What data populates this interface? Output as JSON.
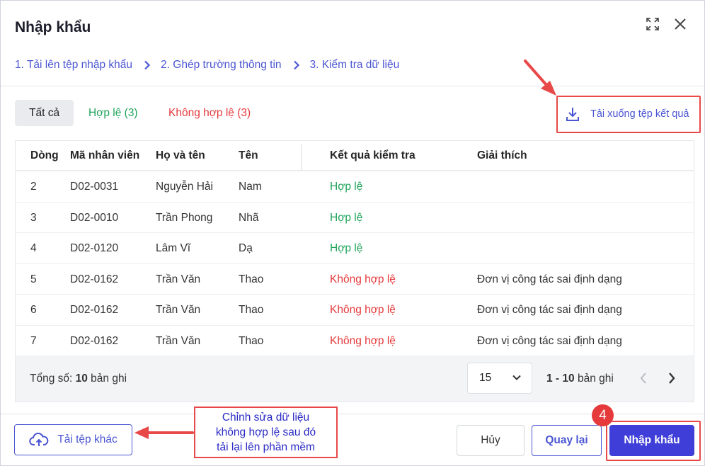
{
  "dialog": {
    "title": "Nhập khẩu"
  },
  "steps": [
    {
      "label": "1. Tải lên tệp nhập khẩu"
    },
    {
      "label": "2. Ghép trường thông tin"
    },
    {
      "label": "3. Kiểm tra dữ liệu"
    }
  ],
  "filters": {
    "all": "Tất cả",
    "valid": "Hợp lệ (3)",
    "invalid": "Không hợp lệ (3)"
  },
  "download_label": "Tải xuống tệp kết quả",
  "table": {
    "columns": [
      "Dòng",
      "Mã nhân viên",
      "Họ và tên",
      "Tên",
      "Kết quả kiểm tra",
      "Giải thích"
    ],
    "rows": [
      {
        "line": "2",
        "code": "D02-0031",
        "lastname": "Nguyễn Hải",
        "name": "Nam",
        "result": "Hợp lệ",
        "status": "ok",
        "note": ""
      },
      {
        "line": "3",
        "code": "D02-0010",
        "lastname": "Trần Phong",
        "name": "Nhã",
        "result": "Hợp lệ",
        "status": "ok",
        "note": ""
      },
      {
        "line": "4",
        "code": "D02-0120",
        "lastname": "Lâm Vĩ",
        "name": "Dạ",
        "result": "Hợp lệ",
        "status": "ok",
        "note": ""
      },
      {
        "line": "5",
        "code": "D02-0162",
        "lastname": "Trần Văn",
        "name": "Thao",
        "result": "Không hợp lệ",
        "status": "bad",
        "note": "Đơn vị công tác sai định dạng"
      },
      {
        "line": "6",
        "code": "D02-0162",
        "lastname": "Trần Văn",
        "name": "Thao",
        "result": "Không hợp lệ",
        "status": "bad",
        "note": "Đơn vị công tác sai định dạng"
      },
      {
        "line": "7",
        "code": "D02-0162",
        "lastname": "Trần Văn",
        "name": "Thao",
        "result": "Không hợp lệ",
        "status": "bad",
        "note": "Đơn vị công tác sai định dạng"
      }
    ]
  },
  "footer": {
    "total_prefix": "Tổng số: ",
    "total_count": "10",
    "total_suffix": " bản ghi",
    "page_size": "15",
    "range_value": "1 - 10",
    "range_suffix": " bản ghi"
  },
  "buttons": {
    "upload": "Tải tệp khác",
    "cancel": "Hủy",
    "back": "Quay lại",
    "import": "Nhập khẩu"
  },
  "annotation": {
    "callout_lines": [
      "Chỉnh sửa dữ liệu",
      "không hợp lệ sau đó",
      "tải lại lên phần mềm"
    ],
    "step_badge": "4"
  },
  "colors": {
    "accent": "#4b56d2",
    "primary_button": "#3f3ed8",
    "valid": "#1ea35a",
    "invalid": "#e5393b",
    "annotation": "#e84848"
  },
  "icons": {
    "expand": "expand-icon",
    "close": "close-icon",
    "step_separator": "chevron-right-icon",
    "download": "download-icon",
    "page_size": "chevron-down-icon",
    "prev": "chevron-left-icon",
    "next": "chevron-right-icon",
    "upload": "cloud-upload-icon"
  }
}
